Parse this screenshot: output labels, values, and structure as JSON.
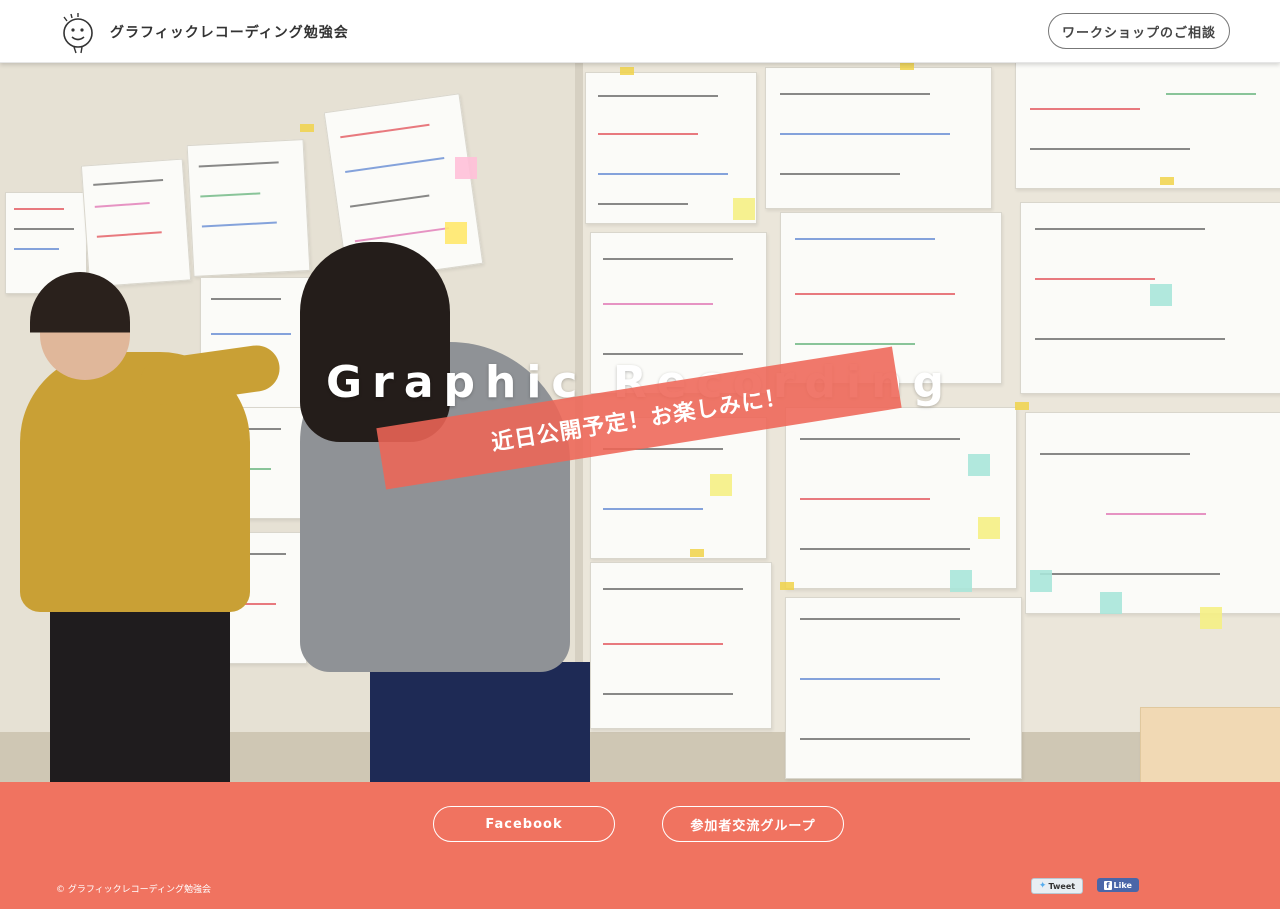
{
  "header": {
    "logo_icon": "smiley-face-icon",
    "site_title": "グラフィックレコーディング勉強会",
    "consult_button": "ワークショップのご相談"
  },
  "hero": {
    "title": "Graphic Recording",
    "ribbon_text": "近日公開予定！お楽しみに！"
  },
  "footer": {
    "facebook_button": "Facebook",
    "group_button": "参加者交流グループ",
    "copyright": "© グラフィックレコーディング勉強会",
    "tweet_label": "Tweet",
    "like_label": "Like"
  },
  "colors": {
    "accent": "#f07360",
    "ribbon": "#ee6556",
    "header_bg": "#ffffff",
    "text": "#333333"
  }
}
